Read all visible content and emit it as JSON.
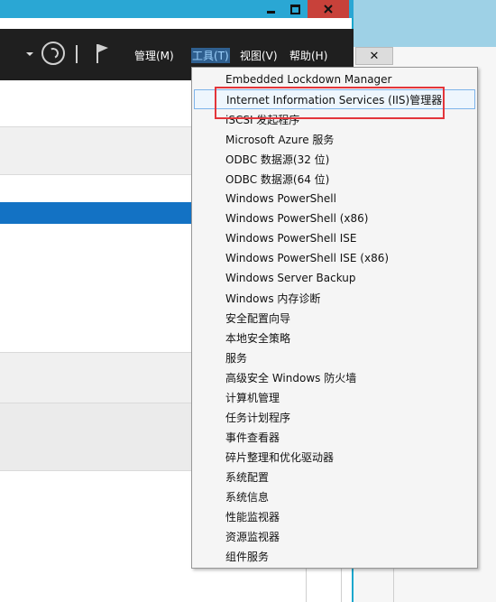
{
  "window": {
    "controls": [
      "minimize",
      "maximize",
      "close"
    ]
  },
  "menubar": {
    "manage": "管理(M)",
    "tools": "工具(T)",
    "view": "视图(V)",
    "help": "帮助(H)"
  },
  "panel": {
    "close_label": "✕"
  },
  "tools_menu": {
    "items": [
      "Embedded Lockdown Manager",
      "Internet Information Services (IIS)管理器",
      "iSCSI 发起程序",
      "Microsoft Azure 服务",
      "ODBC 数据源(32 位)",
      "ODBC 数据源(64 位)",
      "Windows PowerShell",
      "Windows PowerShell (x86)",
      "Windows PowerShell ISE",
      "Windows PowerShell ISE (x86)",
      "Windows Server Backup",
      "Windows 内存诊断",
      "安全配置向导",
      "本地安全策略",
      "服务",
      "高级安全 Windows 防火墙",
      "计算机管理",
      "任务计划程序",
      "事件查看器",
      "碎片整理和优化驱动器",
      "系统配置",
      "系统信息",
      "性能监视器",
      "资源监视器",
      "组件服务"
    ],
    "hovered_index": 1
  },
  "colors": {
    "header_bg": "#1f1f1f",
    "accent_blue": "#1372c4",
    "highlight_red": "#e3353a",
    "close_red": "#c8413a"
  }
}
